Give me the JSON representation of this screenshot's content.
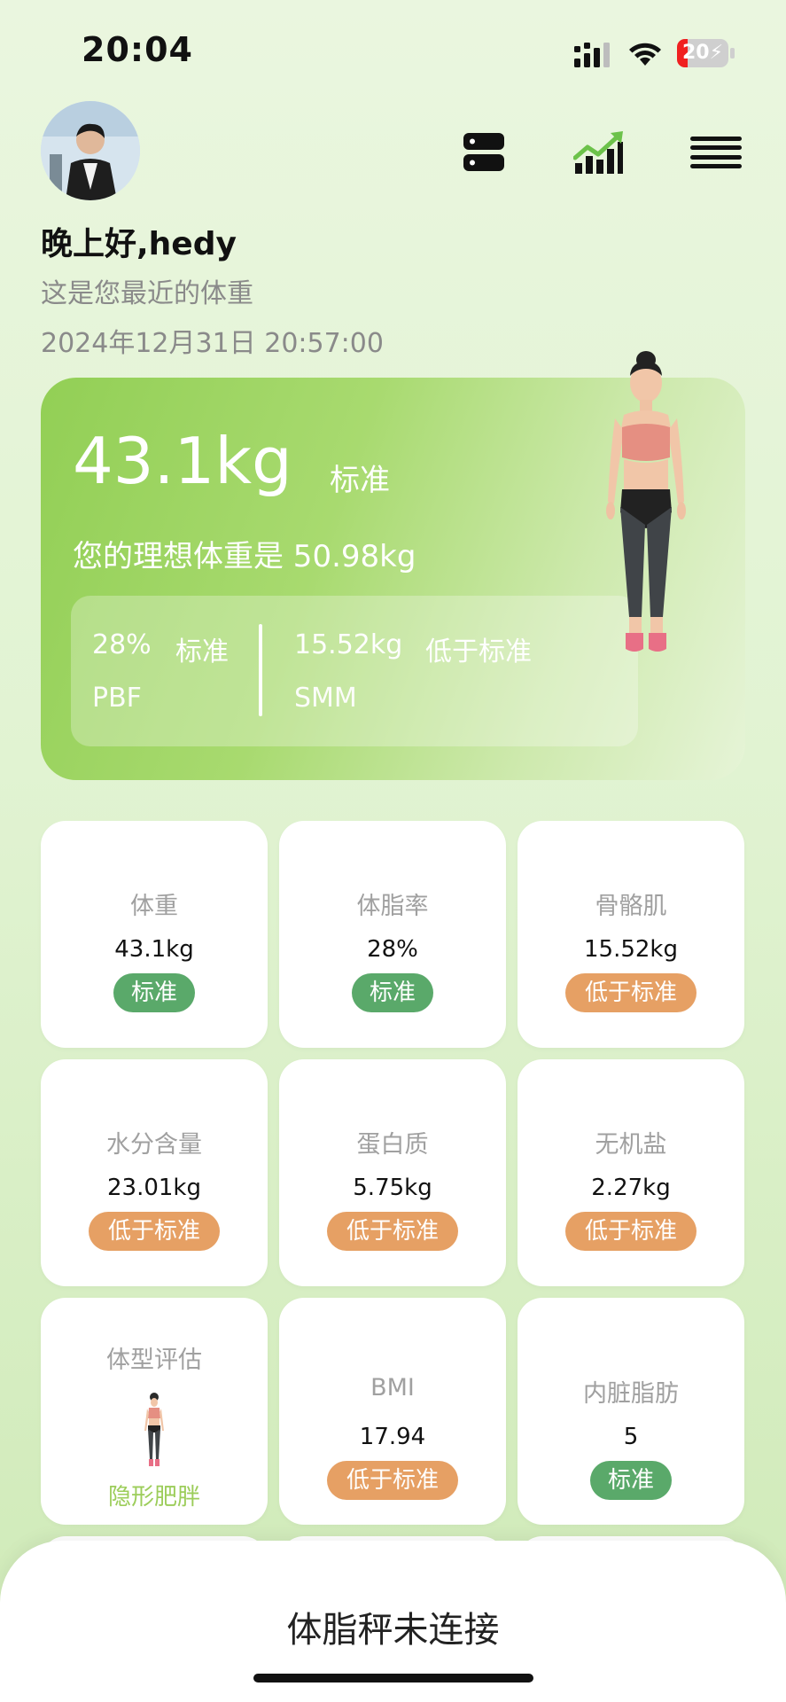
{
  "status_bar": {
    "time": "20:04",
    "battery": "20",
    "battery_level": 0.2
  },
  "header": {
    "greeting": "晚上好,hedy",
    "subtitle": "这是您最近的体重",
    "datetime": "2024年12月31日 20:57:00",
    "icons": [
      "device-list-icon",
      "trend-chart-icon",
      "menu-icon"
    ]
  },
  "hero": {
    "weight": "43.1kg",
    "status": "标准",
    "ideal": "您的理想体重是 50.98kg",
    "pbf": {
      "value": "28%",
      "status": "标准",
      "label": "PBF"
    },
    "smm": {
      "value": "15.52kg",
      "status": "低于标准",
      "label": "SMM"
    }
  },
  "metrics": [
    {
      "name": "体重",
      "value": "43.1kg",
      "status": "标准",
      "status_color": "#5aa96a"
    },
    {
      "name": "体脂率",
      "value": "28%",
      "status": "标准",
      "status_color": "#5aa96a"
    },
    {
      "name": "骨骼肌",
      "value": "15.52kg",
      "status": "低于标准",
      "status_color": "#e6a064"
    },
    {
      "name": "水分含量",
      "value": "23.01kg",
      "status": "低于标准",
      "status_color": "#e6a064"
    },
    {
      "name": "蛋白质",
      "value": "5.75kg",
      "status": "低于标准",
      "status_color": "#e6a064"
    },
    {
      "name": "无机盐",
      "value": "2.27kg",
      "status": "低于标准",
      "status_color": "#e6a064"
    },
    {
      "name": "体型评估",
      "value": "隐形肥胖"
    },
    {
      "name": "BMI",
      "value": "17.94",
      "status": "低于标准",
      "status_color": "#e6a064"
    },
    {
      "name": "内脏脂肪",
      "value": "5",
      "status": "标准",
      "status_color": "#5aa96a"
    }
  ],
  "bottom_sheet": {
    "text": "体脂秤未连接"
  },
  "colors": {
    "accent": "#92cf55",
    "status_green": "#5aa96a",
    "status_orange": "#e6a064",
    "shape_label": "#9ccd5a"
  }
}
